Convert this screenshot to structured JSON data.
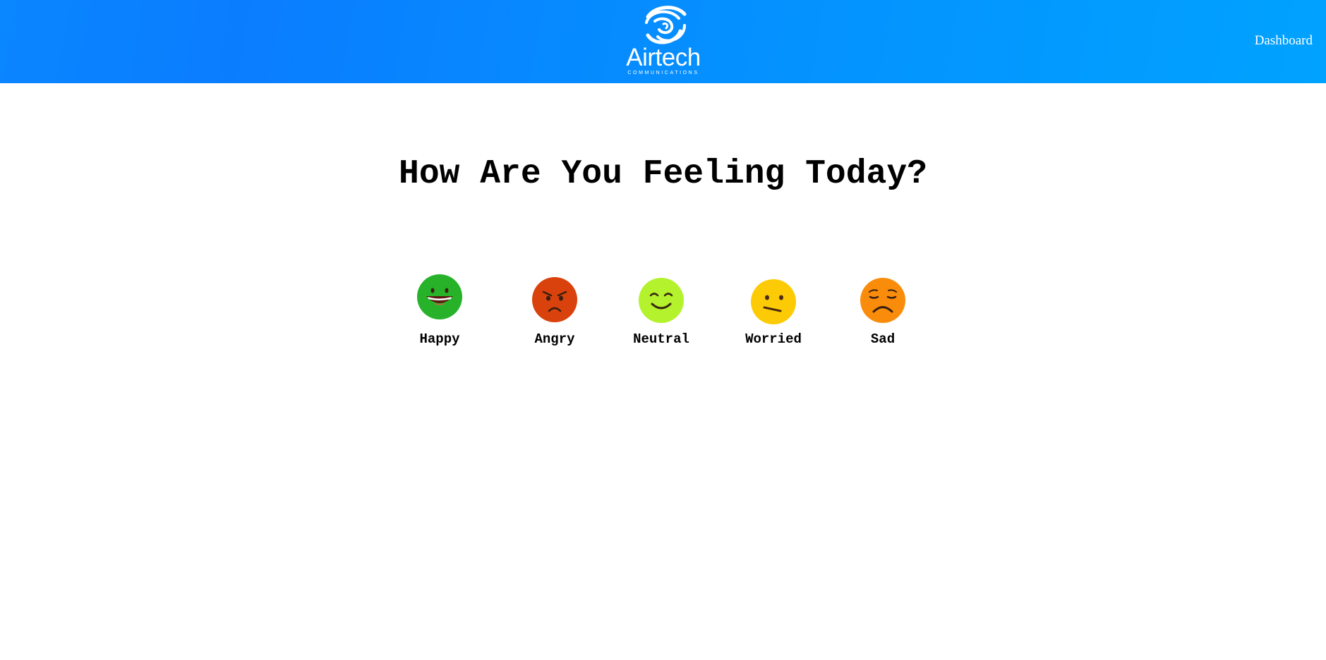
{
  "header": {
    "logo_text": "Airtech",
    "logo_subtext": "COMMUNICATIONS",
    "nav_link": "Dashboard"
  },
  "main": {
    "title": "How Are You Feeling Today?",
    "moods": [
      {
        "label": "Happy",
        "icon": "happy-face-icon",
        "color": "#27b229"
      },
      {
        "label": "Angry",
        "icon": "angry-face-icon",
        "color": "#d9420c"
      },
      {
        "label": "Neutral",
        "icon": "neutral-face-icon",
        "color": "#b3f22c"
      },
      {
        "label": "Worried",
        "icon": "worried-face-icon",
        "color": "#fdcb05"
      },
      {
        "label": "Sad",
        "icon": "sad-face-icon",
        "color": "#f98d0b"
      }
    ]
  },
  "colors": {
    "header_gradient_start": "#0a7dff",
    "header_gradient_end": "#00a2ff"
  }
}
